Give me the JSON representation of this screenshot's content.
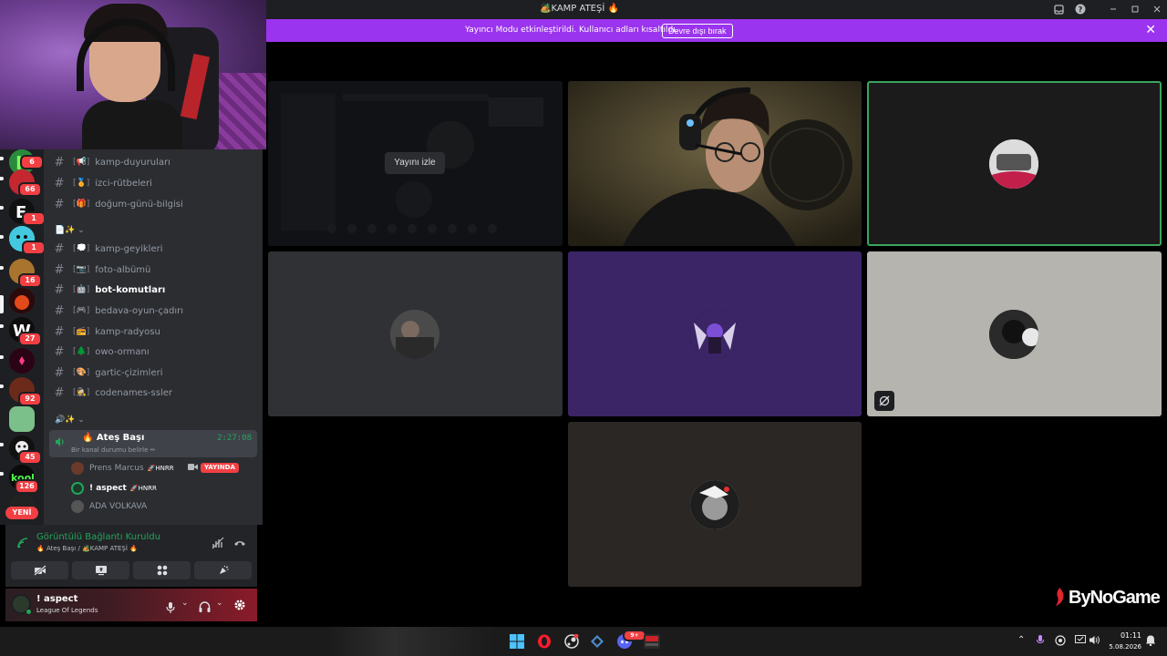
{
  "window": {
    "title": "🏕️KAMP ATEŞİ 🔥",
    "icons": [
      "inbox-icon",
      "help-icon",
      "minimize-icon",
      "maximize-icon",
      "close-icon"
    ]
  },
  "banner": {
    "text": "Yayıncı Modu etkinleştirildi. Kullanıcı adları kısaltıldı.",
    "button": "Devre dışı bırak",
    "color": "#9b34ee"
  },
  "servers": {
    "badges": [
      "6",
      "66",
      "1",
      "1",
      "16",
      "27",
      "92",
      "45",
      "126"
    ],
    "new_label": "YENİ"
  },
  "channels": [
    {
      "emoji": "[📢]",
      "name": "kamp-duyuruları"
    },
    {
      "emoji": "[🏅]",
      "name": "izci-rütbeleri"
    },
    {
      "emoji": "[🎁]",
      "name": "doğum-günü-bilgisi"
    },
    {
      "emoji": "[💭]",
      "name": "kamp-geyikleri"
    },
    {
      "emoji": "[📷]",
      "name": "foto-albümü"
    },
    {
      "emoji": "[🤖]",
      "name": "bot-komutları"
    },
    {
      "emoji": "[🎮]",
      "name": "bedava-oyun-çadırı"
    },
    {
      "emoji": "[📻]",
      "name": "kamp-radyosu"
    },
    {
      "emoji": "[🌲]",
      "name": "owo-ormanı"
    },
    {
      "emoji": "[🎨]",
      "name": "gartic-çizimleri"
    },
    {
      "emoji": "[🕵]",
      "name": "codenames-ssler"
    }
  ],
  "categories": [
    "📄✨ ⌄",
    "🔊✨ ⌄"
  ],
  "voice": {
    "name": "🔥 Ateş Başı",
    "time": "2:27:08",
    "status": "Bir kanal durumu belirle ✏",
    "users": [
      {
        "name": "Prens Marcus",
        "tag": "🚀HNRR",
        "live": "YAYINDA"
      },
      {
        "name": "! aspect",
        "tag": "🚀HNRR"
      },
      {
        "name": "ADA VOLKAVA"
      }
    ]
  },
  "rtc": {
    "status": "Görüntülü Bağlantı Kuruldu",
    "subtitle": "🔥 Ateş Başı / 🏕️KAMP ATEŞİ 🔥"
  },
  "user": {
    "name": "! aspect",
    "activity": "League Of Legends"
  },
  "grid": {
    "watch_label": "Yayını izle"
  },
  "watermark": "ByNoGame",
  "taskbar": {
    "time": "01:11",
    "date": "5.08.2026",
    "discord_badge": "9+"
  }
}
